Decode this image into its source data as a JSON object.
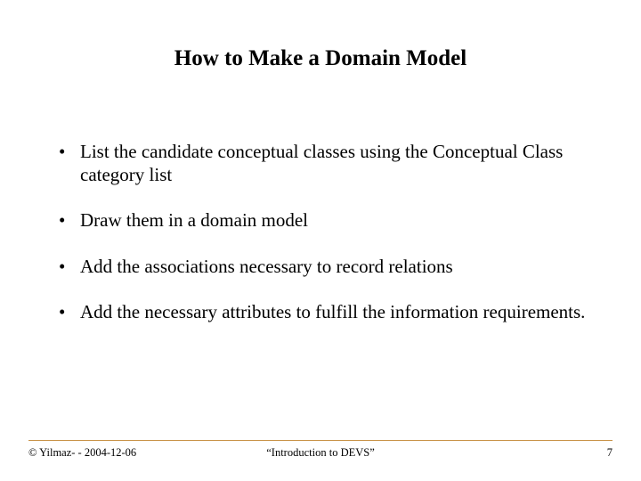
{
  "title": "How to Make a Domain Model",
  "bullets": [
    "List the candidate conceptual classes using the Conceptual Class category list",
    "Draw them in a domain model",
    "Add the associations necessary to record relations",
    "Add the necessary attributes to fulfill the information requirements."
  ],
  "footer": {
    "left": "© Yilmaz- -  2004-12-06",
    "center": "“Introduction to DEVS”",
    "right": "7"
  }
}
